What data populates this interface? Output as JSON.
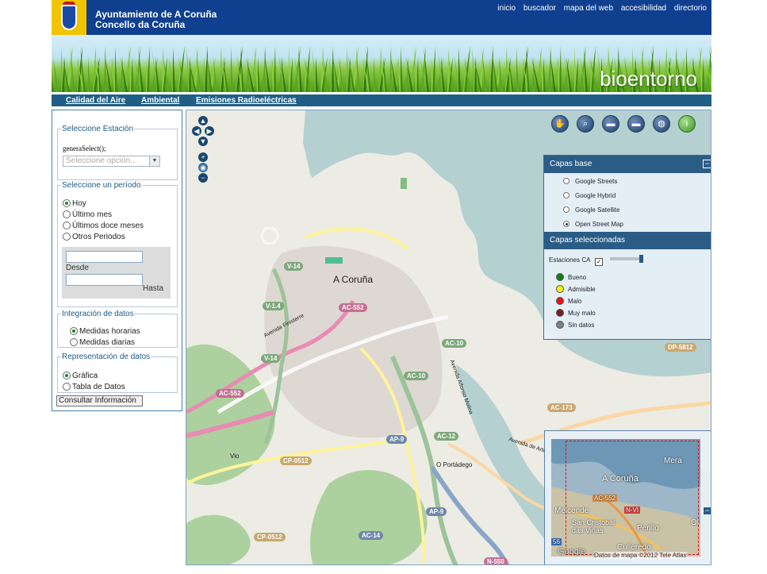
{
  "header": {
    "org_line1": "Ayuntamiento de A Coruña",
    "org_line2": "Concello da Coruña",
    "links": [
      "inicio",
      "buscador",
      "mapa del web",
      "accesibilidad",
      "directorio"
    ],
    "banner_title": "bioentorno"
  },
  "nav": {
    "items": [
      "Calidad del Aire",
      "Ambiental",
      "Emisiones Radioeléctricas"
    ]
  },
  "sidebar": {
    "station": {
      "legend": "Seleccione Estación",
      "code_text": "generaSelect();",
      "select_value": "Seleccione opción..."
    },
    "period": {
      "legend": "Seleccione un período",
      "options": [
        "Hoy",
        "Último mes",
        "Últimos doce meses",
        "Otros Periodos"
      ],
      "selected": "Hoy",
      "from_label": "Desde",
      "to_label": "Hasta"
    },
    "integration": {
      "legend": "Integración de datos",
      "options": [
        "Medidas horarias",
        "Medidas diarias"
      ],
      "selected": "Medidas horarias"
    },
    "representation": {
      "legend": "Representación de datos",
      "options": [
        "Gráfica",
        "Tabla de Datos"
      ],
      "selected": "Gráfica"
    },
    "submit_label": "Consultar Información"
  },
  "map": {
    "city_label": "A Coruña",
    "places": [
      "O Portádego",
      "Vio"
    ],
    "street_labels": [
      "Avenida Finisterre",
      "Avenida Alfonso Molina",
      "Avenida de Arteixo"
    ],
    "road_labels": [
      "V-14",
      "V-1.4",
      "AC-552",
      "AC-10",
      "V-14",
      "AC-552",
      "AC-10",
      "AC-173",
      "DP-5812",
      "AP-9",
      "AC-12",
      "CP-0512",
      "AP-9",
      "CP-0512",
      "AC-14",
      "N-550"
    ],
    "tools": [
      "hand-icon",
      "zoom-box-icon",
      "ruler-icon",
      "area-ruler-icon",
      "globe-icon",
      "info-icon"
    ]
  },
  "layers": {
    "base_title": "Capas base",
    "base_layers": [
      "Google Streets",
      "Google Hybrid",
      "Google Satellite",
      "Open Street Map"
    ],
    "base_selected": "Open Street Map",
    "selected_title": "Capas seleccionadas",
    "overlay_label": "Estaciones CA",
    "legend": [
      {
        "label": "Bueno",
        "color": "#0f7f0f"
      },
      {
        "label": "Admisible",
        "color": "#f4f400"
      },
      {
        "label": "Malo",
        "color": "#ef1010"
      },
      {
        "label": "Muy malo",
        "color": "#7a1e1e"
      },
      {
        "label": "Sin datos",
        "color": "#7f7f7f"
      }
    ]
  },
  "overview": {
    "labels": [
      "A Coruña",
      "Mera",
      "Meicende",
      "San Cristobal das Viñas",
      "Perillo",
      "Culleredo",
      "Ol",
      "AC-552",
      "N-VI",
      "56"
    ],
    "logo": "Google",
    "credits": "Datos de mapa ©2012 Tele Atlas"
  },
  "colors": {
    "header_blue": "#0f3f8f",
    "nav_blue": "#1f5f86",
    "panel_blue": "#2b5c86",
    "sea": "#b5d0d0",
    "land": "#ecece4",
    "forest": "#add19e"
  }
}
